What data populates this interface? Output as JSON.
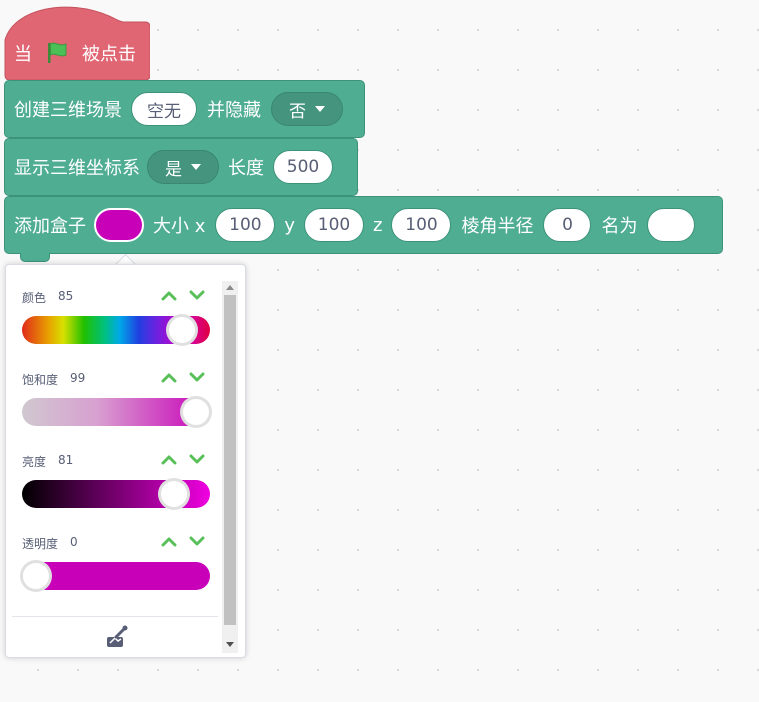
{
  "hat_block": {
    "prefix": "当",
    "suffix": "被点击",
    "flag_icon": "green-flag-icon",
    "color": "#e06673"
  },
  "block1": {
    "label": "创建三维场景",
    "input": "空无",
    "label2": "并隐藏",
    "dropdown": "否"
  },
  "block2": {
    "label": "显示三维坐标系",
    "dropdown": "是",
    "label2": "长度",
    "input": "500"
  },
  "block3": {
    "label": "添加盒子",
    "color": "#c800b8",
    "label_size": "大小 x",
    "x": "100",
    "label_y": "y",
    "y": "100",
    "label_z": "z",
    "z": "100",
    "label_radius": "棱角半径",
    "radius": "0",
    "label_name": "名为",
    "name": ""
  },
  "block_color": "#4fad92",
  "color_picker": {
    "hue": {
      "label": "颜色",
      "value": "85",
      "level": 85
    },
    "saturation": {
      "label": "饱和度",
      "value": "99",
      "level": 99
    },
    "brightness": {
      "label": "亮度",
      "value": "81",
      "level": 81
    },
    "transparency": {
      "label": "透明度",
      "value": "0",
      "level": 0
    },
    "eyedropper_icon": "eyedropper-icon",
    "arrow_color": "#59c059"
  }
}
